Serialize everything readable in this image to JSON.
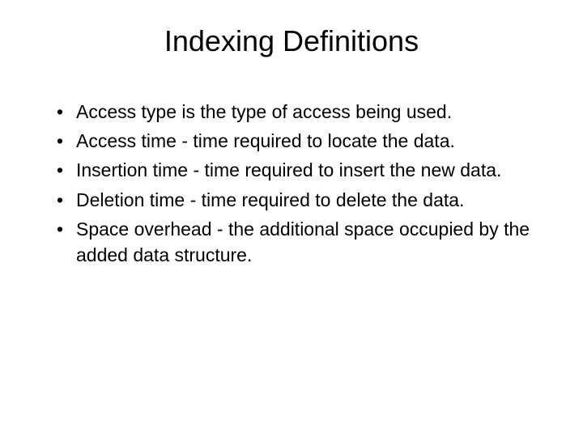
{
  "title": "Indexing Definitions",
  "bullets": [
    "Access type is the type of access being used.",
    "Access time - time required to locate the data.",
    "Insertion time - time required to insert the new data.",
    "Deletion time - time required to delete the data.",
    "Space overhead - the additional space occupied by the added data structure."
  ]
}
